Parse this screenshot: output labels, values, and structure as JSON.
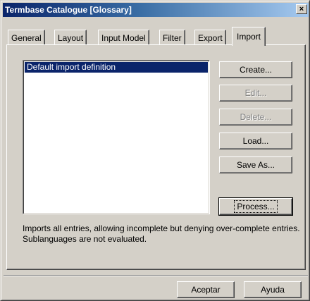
{
  "window": {
    "title": "Termbase Catalogue [Glossary]",
    "close_glyph": "×"
  },
  "tabs": [
    {
      "label": "General"
    },
    {
      "label": "Layout"
    },
    {
      "label": "Input Model"
    },
    {
      "label": "Filter"
    },
    {
      "label": "Export"
    },
    {
      "label": "Import",
      "active": true
    }
  ],
  "import_definitions": {
    "items": [
      "Default import definition"
    ],
    "selected": "Default import definition"
  },
  "buttons": {
    "create": "Create...",
    "edit": "Edit...",
    "delete": "Delete...",
    "load": "Load...",
    "save_as": "Save As...",
    "process": "Process..."
  },
  "description": "Imports all entries, allowing incomplete but denying over-complete entries. Sublanguages are not evaluated.",
  "footer": {
    "accept": "Aceptar",
    "help": "Ayuda"
  },
  "colors": {
    "title_bar": "#0a246a",
    "selection": "#0a246a",
    "face": "#d4d0c8"
  }
}
